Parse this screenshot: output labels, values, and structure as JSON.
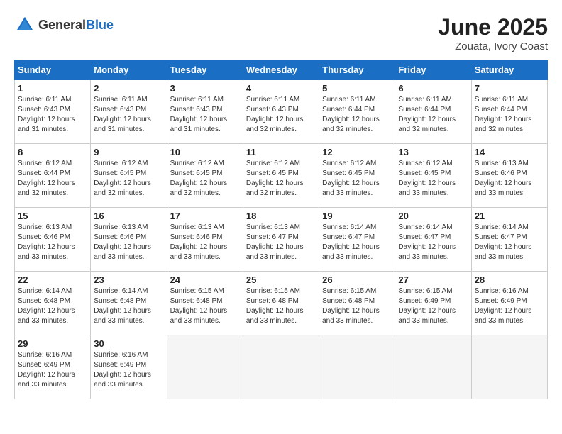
{
  "header": {
    "logo_general": "General",
    "logo_blue": "Blue",
    "month_title": "June 2025",
    "location": "Zouata, Ivory Coast"
  },
  "weekdays": [
    "Sunday",
    "Monday",
    "Tuesday",
    "Wednesday",
    "Thursday",
    "Friday",
    "Saturday"
  ],
  "weeks": [
    [
      {
        "day": "1",
        "sunrise": "6:11 AM",
        "sunset": "6:43 PM",
        "daylight": "12 hours and 31 minutes."
      },
      {
        "day": "2",
        "sunrise": "6:11 AM",
        "sunset": "6:43 PM",
        "daylight": "12 hours and 31 minutes."
      },
      {
        "day": "3",
        "sunrise": "6:11 AM",
        "sunset": "6:43 PM",
        "daylight": "12 hours and 31 minutes."
      },
      {
        "day": "4",
        "sunrise": "6:11 AM",
        "sunset": "6:43 PM",
        "daylight": "12 hours and 32 minutes."
      },
      {
        "day": "5",
        "sunrise": "6:11 AM",
        "sunset": "6:44 PM",
        "daylight": "12 hours and 32 minutes."
      },
      {
        "day": "6",
        "sunrise": "6:11 AM",
        "sunset": "6:44 PM",
        "daylight": "12 hours and 32 minutes."
      },
      {
        "day": "7",
        "sunrise": "6:11 AM",
        "sunset": "6:44 PM",
        "daylight": "12 hours and 32 minutes."
      }
    ],
    [
      {
        "day": "8",
        "sunrise": "6:12 AM",
        "sunset": "6:44 PM",
        "daylight": "12 hours and 32 minutes."
      },
      {
        "day": "9",
        "sunrise": "6:12 AM",
        "sunset": "6:45 PM",
        "daylight": "12 hours and 32 minutes."
      },
      {
        "day": "10",
        "sunrise": "6:12 AM",
        "sunset": "6:45 PM",
        "daylight": "12 hours and 32 minutes."
      },
      {
        "day": "11",
        "sunrise": "6:12 AM",
        "sunset": "6:45 PM",
        "daylight": "12 hours and 32 minutes."
      },
      {
        "day": "12",
        "sunrise": "6:12 AM",
        "sunset": "6:45 PM",
        "daylight": "12 hours and 33 minutes."
      },
      {
        "day": "13",
        "sunrise": "6:12 AM",
        "sunset": "6:45 PM",
        "daylight": "12 hours and 33 minutes."
      },
      {
        "day": "14",
        "sunrise": "6:13 AM",
        "sunset": "6:46 PM",
        "daylight": "12 hours and 33 minutes."
      }
    ],
    [
      {
        "day": "15",
        "sunrise": "6:13 AM",
        "sunset": "6:46 PM",
        "daylight": "12 hours and 33 minutes."
      },
      {
        "day": "16",
        "sunrise": "6:13 AM",
        "sunset": "6:46 PM",
        "daylight": "12 hours and 33 minutes."
      },
      {
        "day": "17",
        "sunrise": "6:13 AM",
        "sunset": "6:46 PM",
        "daylight": "12 hours and 33 minutes."
      },
      {
        "day": "18",
        "sunrise": "6:13 AM",
        "sunset": "6:47 PM",
        "daylight": "12 hours and 33 minutes."
      },
      {
        "day": "19",
        "sunrise": "6:14 AM",
        "sunset": "6:47 PM",
        "daylight": "12 hours and 33 minutes."
      },
      {
        "day": "20",
        "sunrise": "6:14 AM",
        "sunset": "6:47 PM",
        "daylight": "12 hours and 33 minutes."
      },
      {
        "day": "21",
        "sunrise": "6:14 AM",
        "sunset": "6:47 PM",
        "daylight": "12 hours and 33 minutes."
      }
    ],
    [
      {
        "day": "22",
        "sunrise": "6:14 AM",
        "sunset": "6:48 PM",
        "daylight": "12 hours and 33 minutes."
      },
      {
        "day": "23",
        "sunrise": "6:14 AM",
        "sunset": "6:48 PM",
        "daylight": "12 hours and 33 minutes."
      },
      {
        "day": "24",
        "sunrise": "6:15 AM",
        "sunset": "6:48 PM",
        "daylight": "12 hours and 33 minutes."
      },
      {
        "day": "25",
        "sunrise": "6:15 AM",
        "sunset": "6:48 PM",
        "daylight": "12 hours and 33 minutes."
      },
      {
        "day": "26",
        "sunrise": "6:15 AM",
        "sunset": "6:48 PM",
        "daylight": "12 hours and 33 minutes."
      },
      {
        "day": "27",
        "sunrise": "6:15 AM",
        "sunset": "6:49 PM",
        "daylight": "12 hours and 33 minutes."
      },
      {
        "day": "28",
        "sunrise": "6:16 AM",
        "sunset": "6:49 PM",
        "daylight": "12 hours and 33 minutes."
      }
    ],
    [
      {
        "day": "29",
        "sunrise": "6:16 AM",
        "sunset": "6:49 PM",
        "daylight": "12 hours and 33 minutes."
      },
      {
        "day": "30",
        "sunrise": "6:16 AM",
        "sunset": "6:49 PM",
        "daylight": "12 hours and 33 minutes."
      },
      null,
      null,
      null,
      null,
      null
    ]
  ]
}
